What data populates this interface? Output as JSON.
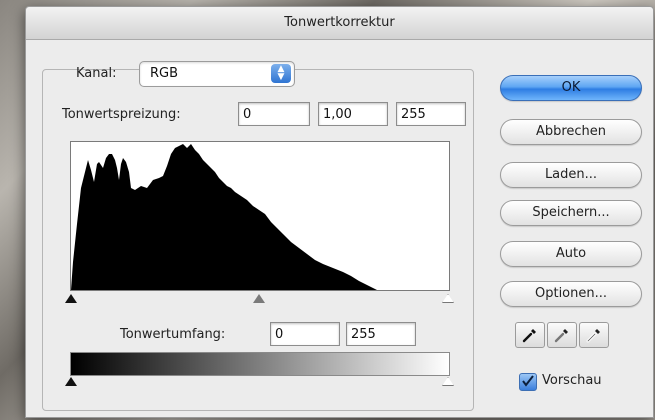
{
  "window": {
    "title": "Tonwertkorrektur"
  },
  "channel": {
    "label": "Kanal:",
    "value": "RGB"
  },
  "input_levels": {
    "label": "Tonwertspreizung:",
    "black": "0",
    "gamma": "1,00",
    "white": "255"
  },
  "output_levels": {
    "label": "Tonwertumfang:",
    "black": "0",
    "white": "255"
  },
  "buttons": {
    "ok": "OK",
    "cancel": "Abbrechen",
    "load": "Laden...",
    "save": "Speichern...",
    "auto": "Auto",
    "options": "Optionen..."
  },
  "preview": {
    "label": "Vorschau",
    "checked": true
  },
  "icons": {
    "black_eyedropper": "eyedropper-black-icon",
    "gray_eyedropper": "eyedropper-gray-icon",
    "white_eyedropper": "eyedropper-white-icon"
  },
  "colors": {
    "accent": "#2e7de3",
    "histogram": "#000000"
  }
}
